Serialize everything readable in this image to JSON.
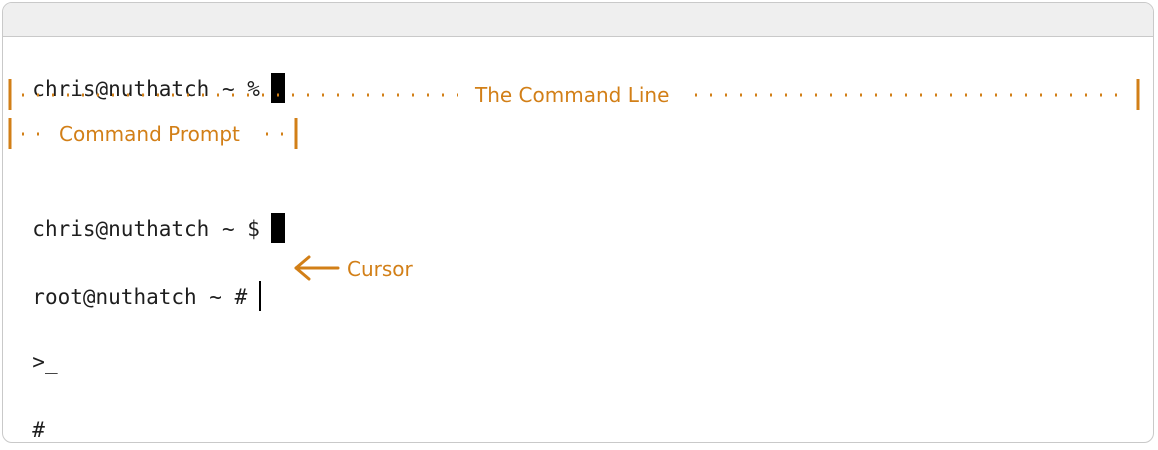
{
  "terminal": {
    "lines": [
      {
        "prompt": "chris@nuthatch ~ %",
        "cursor": "block"
      },
      {
        "prompt": "chris@nuthatch ~ $",
        "cursor": "block"
      },
      {
        "prompt": "root@nuthatch ~ #",
        "cursor": "bar"
      },
      {
        "prompt": ">_",
        "cursor": "none"
      },
      {
        "prompt": "#",
        "cursor": "none"
      }
    ]
  },
  "annotations": {
    "command_line": "The Command Line",
    "command_prompt": "Command Prompt",
    "cursor": "Cursor"
  },
  "colors": {
    "annotation": "#d27f17",
    "text": "#1e1e1e",
    "titlebar": "#efefef",
    "border": "#c9c9c9"
  }
}
